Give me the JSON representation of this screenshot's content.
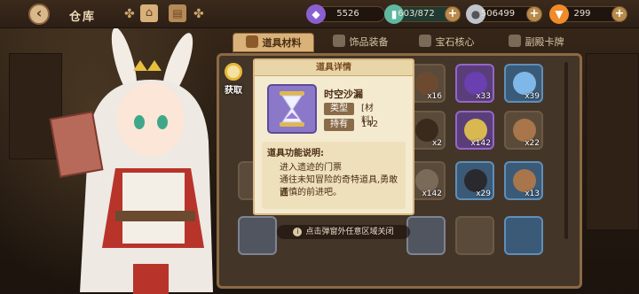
{
  "topbar": {
    "title": "仓库",
    "resources": [
      {
        "icon": "purple-crystal-icon",
        "value": "5526",
        "color": "#8b5fd0"
      },
      {
        "icon": "energy-bottle-icon",
        "value": "603/872",
        "color": "#5fb8a0"
      },
      {
        "icon": "silver-coin-icon",
        "value": "506499",
        "color": "#c0c4cc"
      },
      {
        "icon": "carrot-icon",
        "value": "299",
        "color": "#f08a2a"
      }
    ]
  },
  "tabs": [
    {
      "label": "道具材料",
      "active": true
    },
    {
      "label": "饰品装备",
      "active": false
    },
    {
      "label": "宝石核心",
      "active": false
    },
    {
      "label": "副殿卡牌",
      "active": false
    }
  ],
  "get_button": {
    "label": "获取"
  },
  "detail": {
    "header": "道具详情",
    "name": "时空沙漏",
    "type_key": "类型",
    "type_value": "[材料]",
    "own_key": "持有",
    "own_value": "142",
    "desc_title": "道具功能说明:",
    "desc_lines": [
      "进入遗迹的门票",
      "通往未知冒险的奇特道具,勇敢面",
      "谨慎的前进吧。"
    ]
  },
  "inventory": {
    "counts": [
      "x16",
      "x33",
      "x39",
      "x2",
      "x142",
      "x22",
      "x142",
      "x29",
      "x13"
    ]
  },
  "hint": "点击弹窗外任意区域关闭"
}
